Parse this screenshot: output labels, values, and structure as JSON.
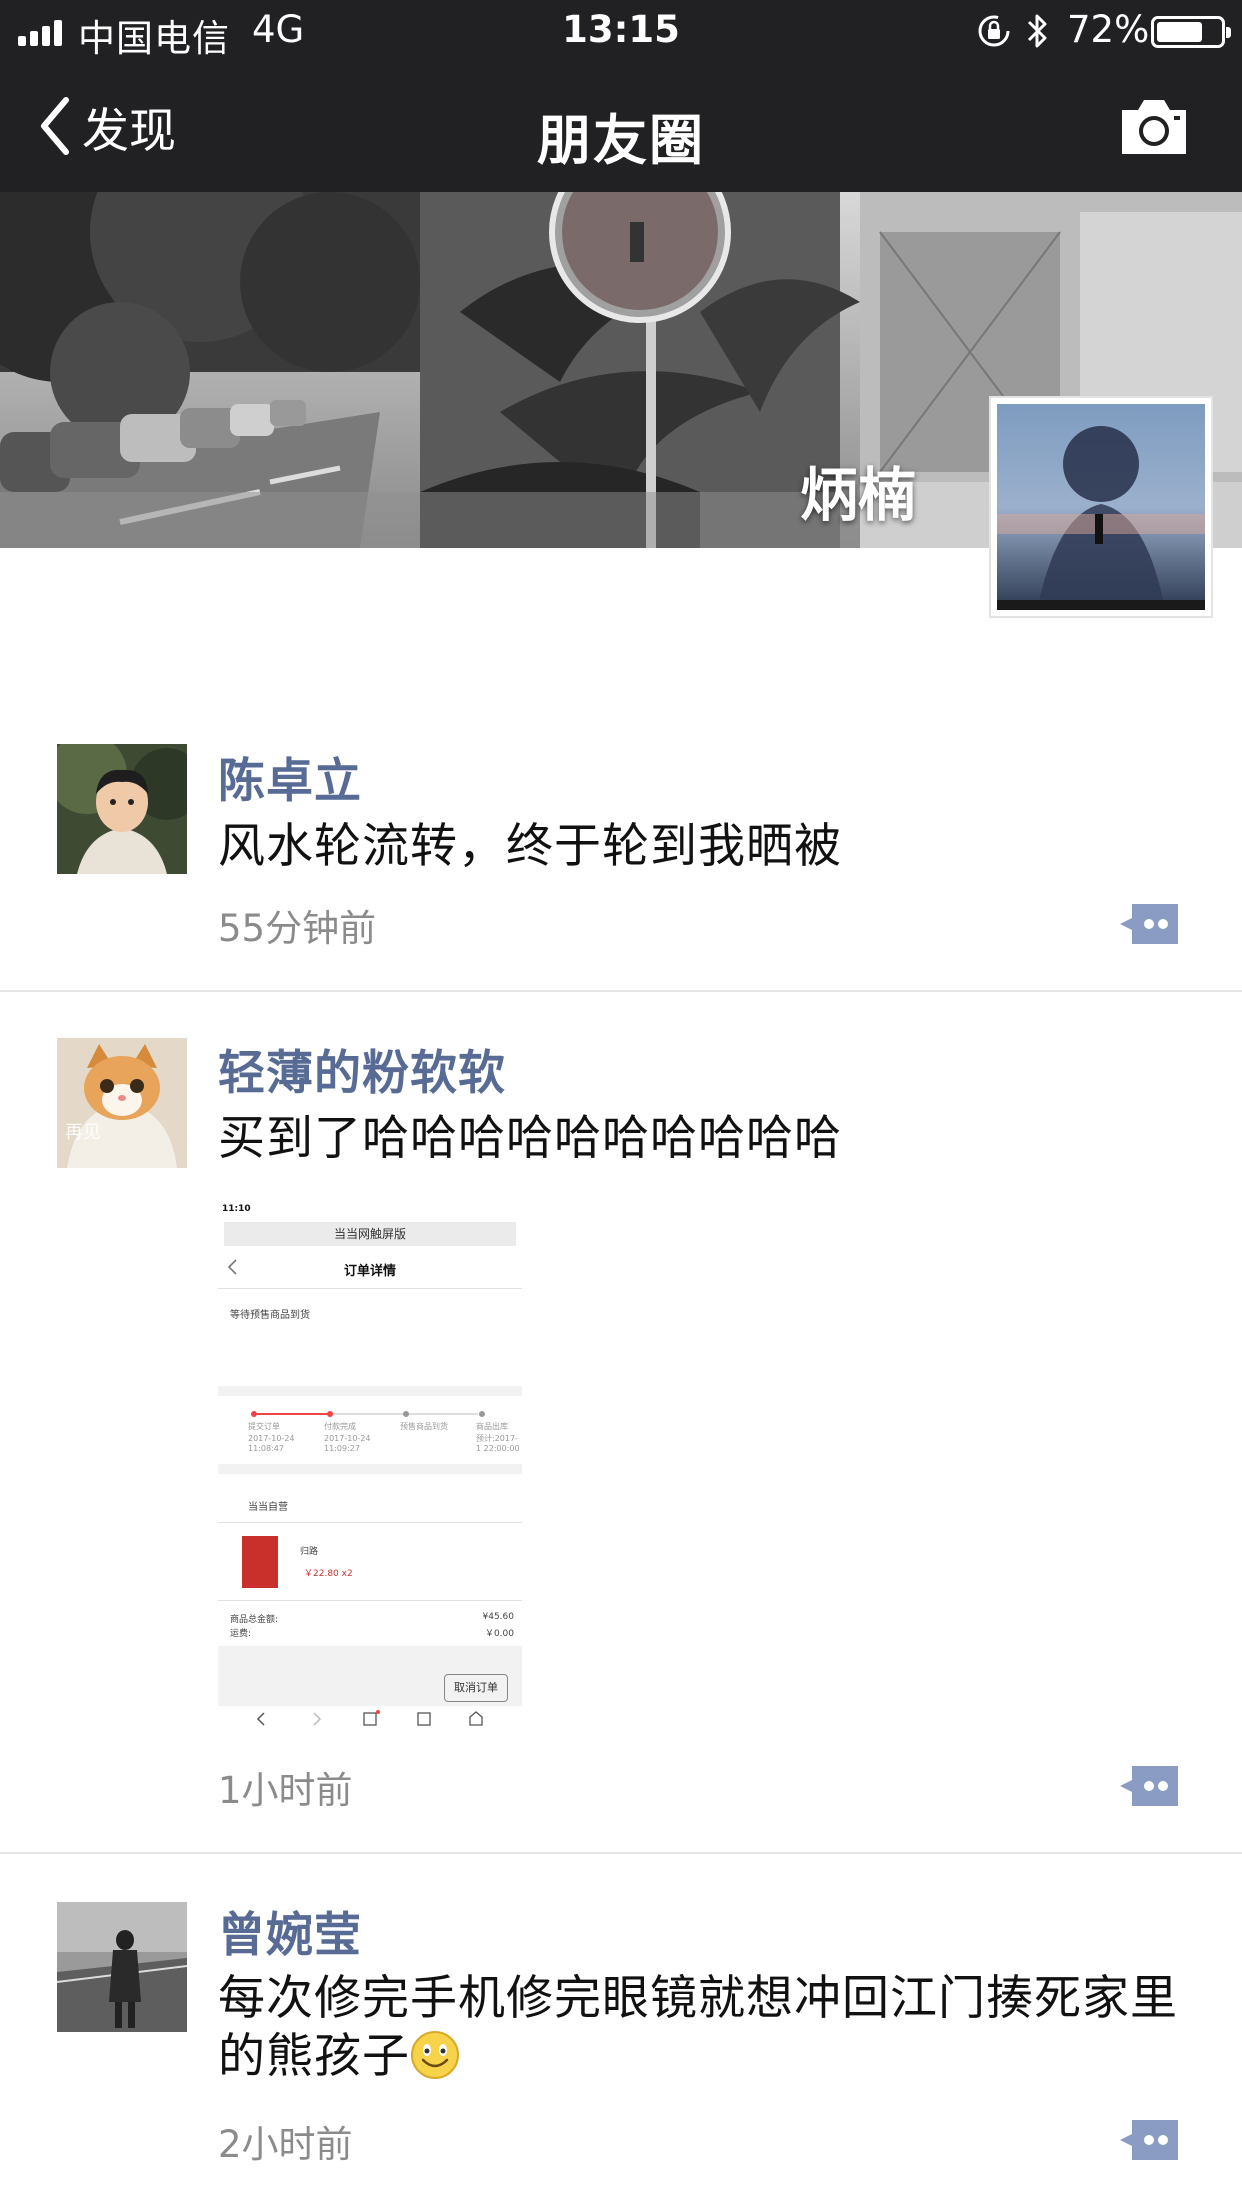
{
  "status_bar": {
    "carrier": "中国电信",
    "network": "4G",
    "time": "13:15",
    "battery_percent": "72%",
    "battery_level": 0.72,
    "signal_bars": 4,
    "icons": [
      "signal-icon",
      "rotation-lock-icon",
      "bluetooth-icon",
      "battery-icon"
    ]
  },
  "nav": {
    "back_label": "发现",
    "title": "朋友圈",
    "right_icon": "camera-icon"
  },
  "profile": {
    "name": "炳楠"
  },
  "posts": [
    {
      "username": "陈卓立",
      "text": "风水轮流转，终于轮到我晒被",
      "time": "55分钟前"
    },
    {
      "username": "轻薄的粉软软",
      "text": "买到了哈哈哈哈哈哈哈哈哈哈",
      "time": "1小时前",
      "image": {
        "status": "11:10",
        "address": "当当网触屏版",
        "title": "订单详情",
        "waiting": "等待预售商品到货",
        "steps": [
          "提交订单",
          "付款完成",
          "预售商品到货",
          "商品出库"
        ],
        "step_dates": [
          "2017-10-24 11:08:47",
          "2017-10-24 11:09:27",
          "",
          "预计:2017-1 22:00:00"
        ],
        "store": "当当自营",
        "book": "归路",
        "price": "￥22.80 x2",
        "total_label": "商品总金额:",
        "total_value": "¥45.60",
        "shipping_label": "运费:",
        "shipping_value": "￥0.00",
        "cancel": "取消订单"
      }
    },
    {
      "username": "曾婉莹",
      "text": "每次修完手机修完眼镜就想冲回江门揍死家里的熊孩子",
      "time": "2小时前",
      "emoji": "smiley-emoji"
    }
  ],
  "colors": {
    "nav_bg": "#212022",
    "username": "#576b95",
    "comment_button": "#8a9bc4",
    "timestamp": "#8b8b8b"
  }
}
